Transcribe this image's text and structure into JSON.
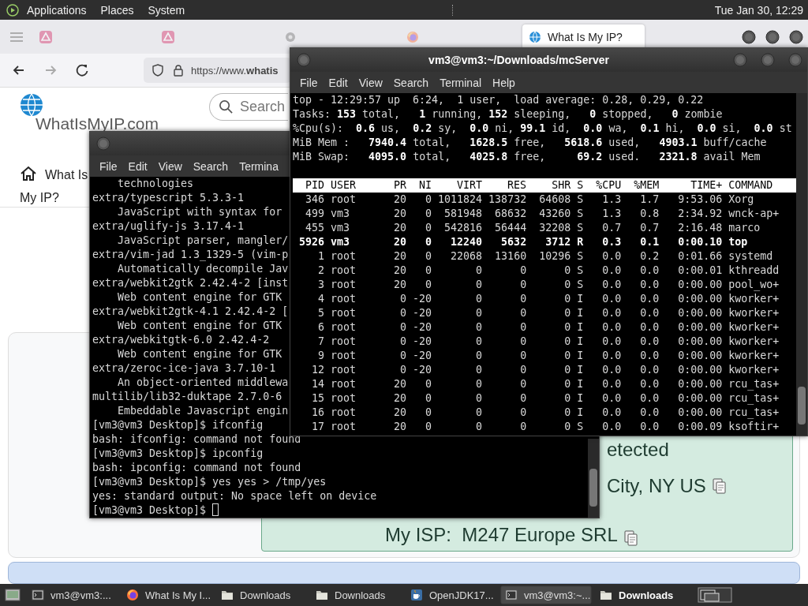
{
  "top_panel": {
    "menus": [
      "Applications",
      "Places",
      "System"
    ],
    "clock": "Tue Jan 30, 12:29"
  },
  "browser": {
    "tabs": [
      {
        "kind": "triangle",
        "selected": false
      },
      {
        "kind": "triangle",
        "selected": false
      },
      {
        "kind": "gear",
        "selected": false
      },
      {
        "kind": "fox",
        "selected": false
      },
      {
        "kind": "globe",
        "label": "What Is My IP?",
        "selected": true
      }
    ],
    "url": "https://www.**whatis**",
    "page": {
      "logo_text": "WhatIsMyIP.com",
      "search": {
        "placeholder": "Search"
      },
      "nav_link": "What Is My IP?",
      "result_lines": [
        {
          "text": "etected",
          "copyable": false
        },
        {
          "text": "City, NY US",
          "copyable": true
        },
        {
          "text": "My ISP:  M247 Europe SRL",
          "copyable": true
        }
      ]
    }
  },
  "back_terminal": {
    "menus": [
      "File",
      "Edit",
      "View",
      "Search",
      "Termina"
    ],
    "cursor": true,
    "lines": [
      "    technologies",
      "extra/typescript 5.3.3-1",
      "    JavaScript with syntax for",
      "extra/uglify-js 3.17.4-1",
      "    JavaScript parser, mangler/",
      "extra/vim-jad 1.3_1329-5 (vim-p",
      "    Automatically decompile Jav",
      "extra/webkit2gtk 2.42.4-2 [inst",
      "    Web content engine for GTK",
      "extra/webkit2gtk-4.1 2.42.4-2 [",
      "    Web content engine for GTK",
      "extra/webkitgtk-6.0 2.42.4-2",
      "    Web content engine for GTK",
      "extra/zeroc-ice-java 3.7.10-1",
      "    An object-oriented middlewa",
      "multilib/lib32-duktape 2.7.0-6",
      "    Embeddable Javascript engin",
      "[vm3@vm3 Desktop]$ ifconfig",
      "bash: ifconfig: command not found",
      "[vm3@vm3 Desktop]$ ipconfig",
      "bash: ipconfig: command not found",
      "[vm3@vm3 Desktop]$ yes yes > /tmp/yes",
      "yes: standard output: No space left on device",
      "[vm3@vm3 Desktop]$ "
    ]
  },
  "top_terminal": {
    "title": "vm3@vm3:~/Downloads/mcServer",
    "menus": [
      "File",
      "Edit",
      "View",
      "Search",
      "Terminal",
      "Help"
    ],
    "summary": [
      "top - 12:29:57 up  6:24,  1 user,  load average: 0.28, 0.29, 0.22",
      "Tasks: **153** total,   **1** running, **152** sleeping,   **0** stopped,   **0** zombie",
      "%Cpu(s):  **0.6** us,  **0.2** sy,  **0.0** ni, **99.1** id,  **0.0** wa,  **0.1** hi,  **0.0** si,  **0.0** st",
      "MiB Mem :   **7940.4** total,   **1628.5** free,   **5618.6** used,   **4903.1** buff/cache",
      "MiB Swap:   **4095.0** total,   **4025.8** free,     **69.2** used.   **2321.8** avail Mem"
    ],
    "columns": [
      "PID",
      "USER",
      "PR",
      "NI",
      "VIRT",
      "RES",
      "SHR",
      "S",
      "%CPU",
      "%MEM",
      "TIME+",
      "COMMAND"
    ],
    "rows": [
      {
        "highlighted": false,
        "cells": [
          "346",
          "root",
          "20",
          "0",
          "1011824",
          "138732",
          "64608",
          "S",
          "1.3",
          "1.7",
          "9:53.06",
          "Xorg"
        ]
      },
      {
        "highlighted": false,
        "cells": [
          "499",
          "vm3",
          "20",
          "0",
          "581948",
          "68632",
          "43260",
          "S",
          "1.3",
          "0.8",
          "2:34.92",
          "wnck-ap+"
        ]
      },
      {
        "highlighted": false,
        "cells": [
          "455",
          "vm3",
          "20",
          "0",
          "542816",
          "56444",
          "32208",
          "S",
          "0.7",
          "0.7",
          "2:16.48",
          "marco"
        ]
      },
      {
        "highlighted": true,
        "cells": [
          "5926",
          "vm3",
          "20",
          "0",
          "12240",
          "5632",
          "3712",
          "R",
          "0.3",
          "0.1",
          "0:00.10",
          "top"
        ]
      },
      {
        "highlighted": false,
        "cells": [
          "1",
          "root",
          "20",
          "0",
          "22068",
          "13160",
          "10296",
          "S",
          "0.0",
          "0.2",
          "0:01.66",
          "systemd"
        ]
      },
      {
        "highlighted": false,
        "cells": [
          "2",
          "root",
          "20",
          "0",
          "0",
          "0",
          "0",
          "S",
          "0.0",
          "0.0",
          "0:00.01",
          "kthreadd"
        ]
      },
      {
        "highlighted": false,
        "cells": [
          "3",
          "root",
          "20",
          "0",
          "0",
          "0",
          "0",
          "S",
          "0.0",
          "0.0",
          "0:00.00",
          "pool_wo+"
        ]
      },
      {
        "highlighted": false,
        "cells": [
          "4",
          "root",
          "0",
          "-20",
          "0",
          "0",
          "0",
          "I",
          "0.0",
          "0.0",
          "0:00.00",
          "kworker+"
        ]
      },
      {
        "highlighted": false,
        "cells": [
          "5",
          "root",
          "0",
          "-20",
          "0",
          "0",
          "0",
          "I",
          "0.0",
          "0.0",
          "0:00.00",
          "kworker+"
        ]
      },
      {
        "highlighted": false,
        "cells": [
          "6",
          "root",
          "0",
          "-20",
          "0",
          "0",
          "0",
          "I",
          "0.0",
          "0.0",
          "0:00.00",
          "kworker+"
        ]
      },
      {
        "highlighted": false,
        "cells": [
          "7",
          "root",
          "0",
          "-20",
          "0",
          "0",
          "0",
          "I",
          "0.0",
          "0.0",
          "0:00.00",
          "kworker+"
        ]
      },
      {
        "highlighted": false,
        "cells": [
          "9",
          "root",
          "0",
          "-20",
          "0",
          "0",
          "0",
          "I",
          "0.0",
          "0.0",
          "0:00.00",
          "kworker+"
        ]
      },
      {
        "highlighted": false,
        "cells": [
          "12",
          "root",
          "0",
          "-20",
          "0",
          "0",
          "0",
          "I",
          "0.0",
          "0.0",
          "0:00.00",
          "kworker+"
        ]
      },
      {
        "highlighted": false,
        "cells": [
          "14",
          "root",
          "20",
          "0",
          "0",
          "0",
          "0",
          "I",
          "0.0",
          "0.0",
          "0:00.00",
          "rcu_tas+"
        ]
      },
      {
        "highlighted": false,
        "cells": [
          "15",
          "root",
          "20",
          "0",
          "0",
          "0",
          "0",
          "I",
          "0.0",
          "0.0",
          "0:00.00",
          "rcu_tas+"
        ]
      },
      {
        "highlighted": false,
        "cells": [
          "16",
          "root",
          "20",
          "0",
          "0",
          "0",
          "0",
          "I",
          "0.0",
          "0.0",
          "0:00.00",
          "rcu_tas+"
        ]
      },
      {
        "highlighted": false,
        "cells": [
          "17",
          "root",
          "20",
          "0",
          "0",
          "0",
          "0",
          "S",
          "0.0",
          "0.0",
          "0:00.09",
          "ksoftir+"
        ]
      }
    ]
  },
  "taskbar": {
    "items": [
      {
        "kind": "terminal",
        "label": "vm3@vm3:...",
        "selected": false,
        "emphasized": false
      },
      {
        "kind": "fox",
        "label": "What Is My I...",
        "selected": false,
        "emphasized": false
      },
      {
        "kind": "folder",
        "label": "Downloads",
        "selected": false,
        "emphasized": false
      },
      {
        "kind": "folder",
        "label": "Downloads",
        "selected": false,
        "emphasized": false
      },
      {
        "kind": "cup",
        "label": "OpenJDK17...",
        "selected": false,
        "emphasized": false
      },
      {
        "kind": "terminal",
        "label": "vm3@vm3:~...",
        "selected": true,
        "emphasized": false
      },
      {
        "kind": "folder",
        "label": "Downloads",
        "selected": false,
        "emphasized": true
      }
    ]
  }
}
